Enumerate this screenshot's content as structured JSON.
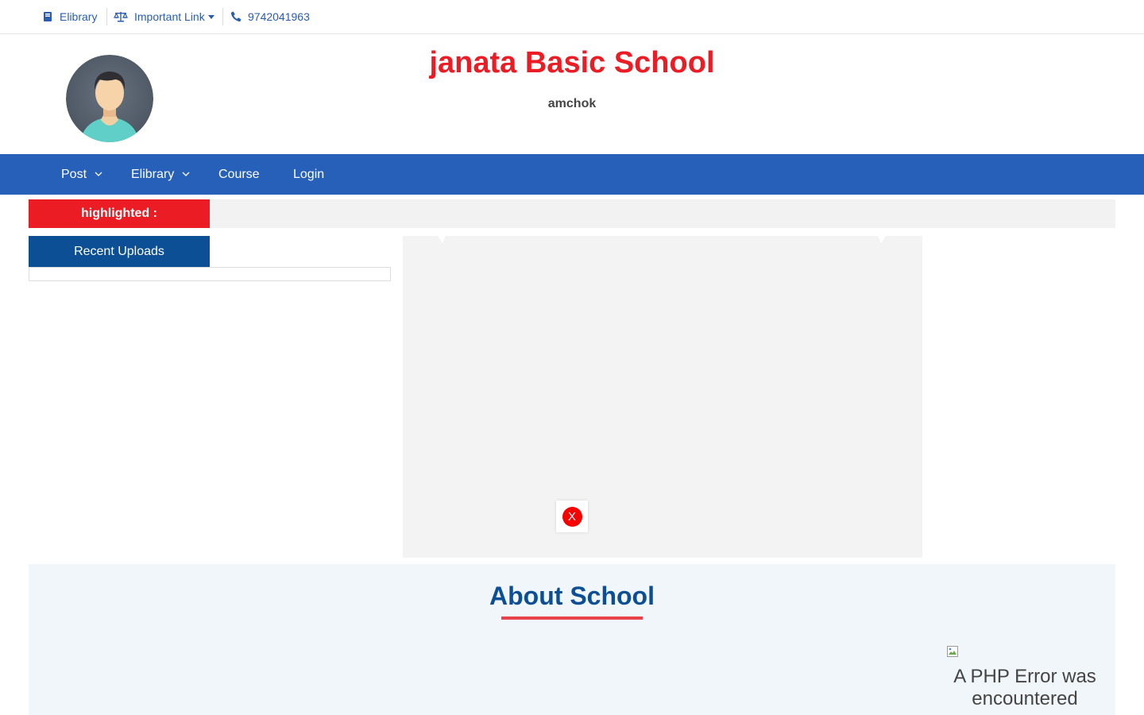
{
  "topbar": {
    "elibrary_label": "Elibrary",
    "important_link_label": "Important Link",
    "phone": "9742041963"
  },
  "header": {
    "school_name": "janata Basic School",
    "location": "amchok"
  },
  "nav": {
    "items": [
      {
        "label": "Post",
        "has_dropdown": true
      },
      {
        "label": "Elibrary",
        "has_dropdown": true
      },
      {
        "label": "Course",
        "has_dropdown": false
      },
      {
        "label": "Login",
        "has_dropdown": false
      }
    ]
  },
  "ticker": {
    "label": "highlighted :"
  },
  "recent": {
    "title": "Recent Uploads"
  },
  "popup": {
    "close_label": "X"
  },
  "about": {
    "title": "About School",
    "error_text": "A PHP Error was encountered"
  },
  "colors": {
    "brand_blue": "#2660b9",
    "dark_blue": "#0d4f95",
    "accent_red": "#ec1c24"
  }
}
